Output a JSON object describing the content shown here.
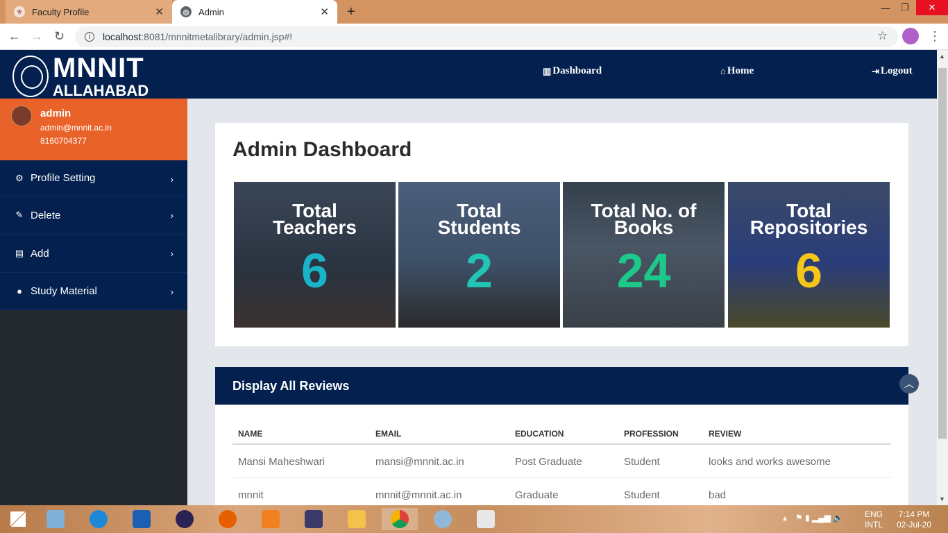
{
  "browser": {
    "tabs": [
      {
        "title": "Faculty Profile",
        "active": false
      },
      {
        "title": "Admin",
        "active": true
      }
    ],
    "url_host": "localhost",
    "url_path": ":8081/mnnitmetalibrary/admin.jsp#!",
    "window_controls": [
      "minimize",
      "restore",
      "close"
    ]
  },
  "header": {
    "logo_line1": "MNNIT",
    "logo_line2": "ALLAHABAD",
    "nav": [
      {
        "label": "Dashboard",
        "icon": "bar-chart-icon"
      },
      {
        "label": "Home",
        "icon": "home-icon"
      },
      {
        "label": "Logout",
        "icon": "logout-icon"
      }
    ]
  },
  "user": {
    "name": "admin",
    "email": "admin@mnnit.ac.in",
    "phone": "8160704377"
  },
  "sidebar": {
    "items": [
      {
        "label": "Profile Setting",
        "icon": "gears-icon"
      },
      {
        "label": "Delete",
        "icon": "pencil-icon"
      },
      {
        "label": "Add",
        "icon": "book-icon"
      },
      {
        "label": "Study Material",
        "icon": "comment-icon"
      }
    ]
  },
  "dashboard": {
    "title": "Admin Dashboard",
    "stats": [
      {
        "label_line1": "Total",
        "label_line2": "Teachers",
        "value": "6",
        "color": "#1ab4c8"
      },
      {
        "label_line1": "Total",
        "label_line2": "Students",
        "value": "2",
        "color": "#20c5b5"
      },
      {
        "label_line1": "Total No. of",
        "label_line2": "Books",
        "value": "24",
        "color": "#1dc98a"
      },
      {
        "label_line1": "Total",
        "label_line2": "Repositories",
        "value": "6",
        "color": "#f5c518"
      }
    ]
  },
  "reviews": {
    "title": "Display All Reviews",
    "columns": [
      "NAME",
      "EMAIL",
      "EDUCATION",
      "PROFESSION",
      "REVIEW"
    ],
    "rows": [
      [
        "Mansi Maheshwari",
        "mansi@mnnit.ac.in",
        "Post Graduate",
        "Student",
        "looks and works awesome"
      ],
      [
        "mnnit",
        "mnnit@mnnit.ac.in",
        "Graduate",
        "Student",
        "bad"
      ]
    ]
  },
  "taskbar": {
    "lang_line1": "ENG",
    "lang_line2": "INTL",
    "time": "7:14 PM",
    "date": "02-Jul-20"
  },
  "colors": {
    "navy": "#03204e",
    "orange": "#e9622a",
    "sidebar_dark": "#24292e"
  }
}
